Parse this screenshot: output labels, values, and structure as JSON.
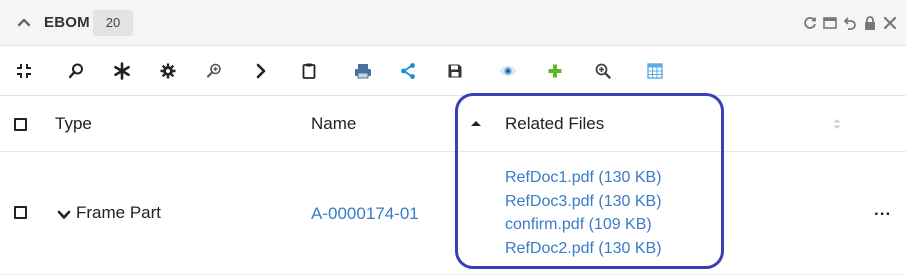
{
  "header": {
    "title": "EBOM",
    "count": "20",
    "window_controls": [
      "refresh-icon",
      "maximize-icon",
      "undo-icon",
      "lock-icon",
      "close-icon"
    ]
  },
  "toolbar": {
    "buttons": [
      "collapse-icon",
      "search-icon",
      "asterisk-icon",
      "settings-icon",
      "zoom-in-icon",
      "chevron-right-icon",
      "clipboard-icon",
      "print-icon",
      "share-icon",
      "save-icon",
      "eye-icon",
      "add-icon",
      "magnify-icon",
      "calendar-icon"
    ]
  },
  "grid": {
    "columns": [
      "Type",
      "Name",
      "Related Files"
    ],
    "sort_indicator": "ascending",
    "rows": [
      {
        "type": "Frame Part",
        "name": "A-0000174-01",
        "files": [
          "RefDoc1.pdf (130 KB)",
          "RefDoc3.pdf (130 KB)",
          "confirm.pdf (109 KB)",
          "RefDoc2.pdf (130 KB)"
        ],
        "actions": "..."
      }
    ]
  },
  "colors": {
    "link": "#3a7bc8",
    "highlight_border": "#3a3fb8",
    "share_icon": "#1f8ad6",
    "add_icon": "#5cb82a",
    "print_icon": "#4a6f9e",
    "calendar_icon": "#5aaee8"
  }
}
